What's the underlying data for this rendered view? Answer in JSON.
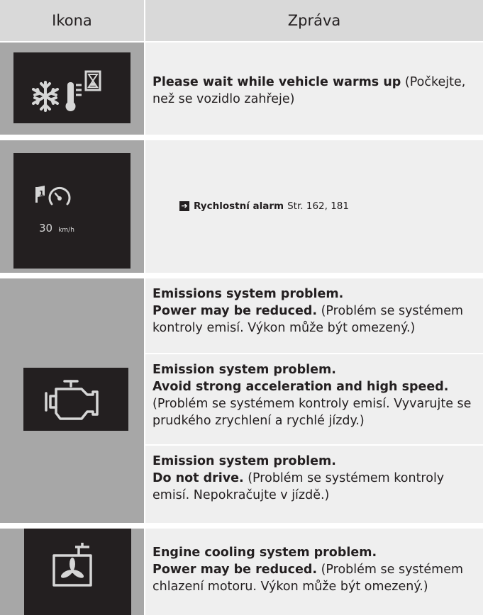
{
  "table": {
    "headers": {
      "icon": "Ikona",
      "message": "Zpráva"
    },
    "rows": [
      {
        "icon_name": "warming-up-snowflake-thermometer-hourglass-icon",
        "message_bold": "Please wait while vehicle warms up",
        "message_text": " (Počkejte, než se vozidlo zahřeje)"
      },
      {
        "icon_name": "speed-alarm-icon",
        "icon_speed_value": "30",
        "icon_speed_unit": "km/h",
        "xref_arrow": "➔",
        "xref_bold": "Rychlostní alarm",
        "xref_text": "Str. 162, 181"
      },
      {
        "icon_name": "check-engine-icon",
        "messages": [
          {
            "line1": "Emissions system problem.",
            "line2": "Power may be reduced.",
            "text": " (Problém se systémem kontroly emisí. Výkon může být omezený.)"
          },
          {
            "line1": "Emission system problem.",
            "line2": "Avoid strong acceleration and high speed.",
            "text": " (Problém se systémem kontroly emisí. Vyvarujte se prudkého zrychlení a rychlé jízdy.)"
          },
          {
            "line1": "Emission system problem.",
            "line2": "Do not drive.",
            "text": " (Problém se systémem kontroly emisí. Nepokračujte v jízdě.)"
          }
        ]
      },
      {
        "icon_name": "engine-coolant-warning-icon",
        "line1": "Engine cooling system problem.",
        "line2": "Power may be reduced.",
        "text": " (Problém se systémem chlazení motoru. Výkon může být omezený.)"
      }
    ]
  },
  "colors": {
    "header_bg": "#d9d9d9",
    "icon_cell_bg": "#a7a7a7",
    "message_cell_bg": "#efefef",
    "icon_panel_bg": "#231f20",
    "icon_fg": "#d6d6d6",
    "text": "#231f20"
  }
}
